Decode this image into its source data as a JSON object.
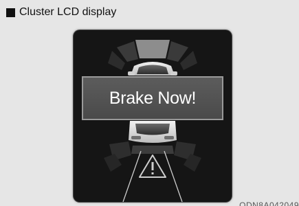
{
  "caption": {
    "text": "Cluster LCD display"
  },
  "lcd": {
    "message": "Brake Now!",
    "warning_icon": "warning-triangle-icon",
    "vehicle_icon": "car-icon",
    "sensor_zone_icon": "sensor-arc-icon"
  },
  "figure_code": "ODN8A042049"
}
